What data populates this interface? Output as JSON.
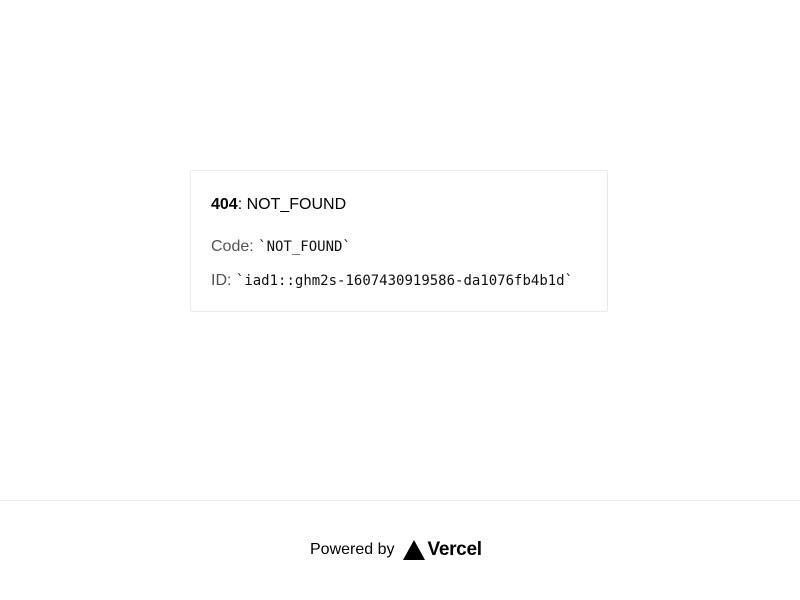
{
  "error": {
    "status_code": "404",
    "status_text": ": NOT_FOUND",
    "code_label": "Code: ",
    "code_value": "`NOT_FOUND`",
    "id_label": "ID: ",
    "id_value": "`iad1::ghm2s-1607430919586-da1076fb4b1d`"
  },
  "footer": {
    "powered_label": "Powered by",
    "brand_name": "Vercel",
    "brand_icon": "vercel-triangle-icon"
  },
  "colors": {
    "border": "#eaeaea",
    "text": "#000000",
    "muted": "#555555"
  }
}
